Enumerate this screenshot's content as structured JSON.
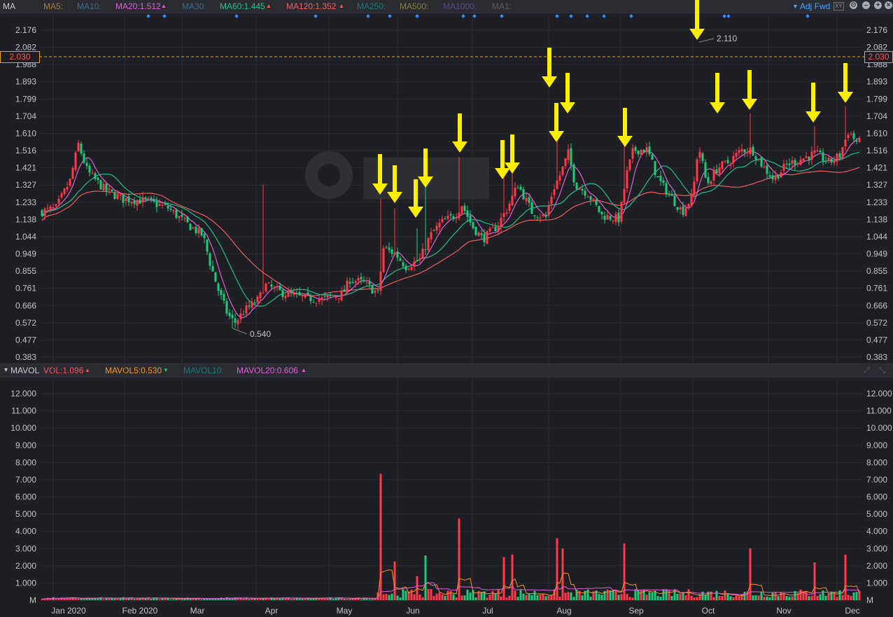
{
  "indicators": {
    "main_label": "MA",
    "ma5": "MA5:",
    "ma10": "MA10:",
    "ma20": "MA20:1.512",
    "ma30": "MA30:",
    "ma60": "MA60:1.445",
    "ma120": "MA120:1.352",
    "ma250": "MA250:",
    "ma500": "MA500:",
    "ma1000": "MA1000:",
    "ma1": "MA1:",
    "adj": "Adj Fwd",
    "xy": "XY"
  },
  "volume_indicators": {
    "label": "MAVOL",
    "vol": "VOL:1.096",
    "mavol5": "MAVOL5:0.530",
    "mavol10": "MAVOL10:",
    "mavol20": "MAVOL20:0.606"
  },
  "current_price_tag": "2.030",
  "colors": {
    "up": "#ff3b4a",
    "down": "#21c97a",
    "ma20": "#e05fd6",
    "ma60": "#1fbf8f",
    "ma120": "#f25c5c",
    "mavol5": "#f0952a",
    "mavol20": "#e05fd6",
    "arrow": "#ffee00"
  },
  "chart_data": {
    "type": "candlestick",
    "price_axis_ticks": [
      "2.176",
      "2.082",
      "1.988",
      "1.893",
      "1.799",
      "1.704",
      "1.610",
      "1.516",
      "1.421",
      "1.327",
      "1.233",
      "1.138",
      "1.044",
      "0.949",
      "0.855",
      "0.761",
      "0.666",
      "0.572",
      "0.477",
      "0.383"
    ],
    "volume_axis_ticks": [
      "12.000",
      "11.000",
      "10.000",
      "9.000",
      "8.000",
      "7.000",
      "6.000",
      "5.000",
      "4.000",
      "3.000",
      "2.000",
      "1.000",
      "M"
    ],
    "x_labels": [
      "Jan 2020",
      "Feb 2020",
      "Mar",
      "Apr",
      "May",
      "Jun",
      "Jul",
      "Aug",
      "Sep",
      "Oct",
      "Nov",
      "Dec"
    ],
    "annotations": {
      "high": "2.110",
      "low": "0.540"
    },
    "ylim": [
      0.383,
      2.176
    ],
    "current_price": 2.03
  }
}
